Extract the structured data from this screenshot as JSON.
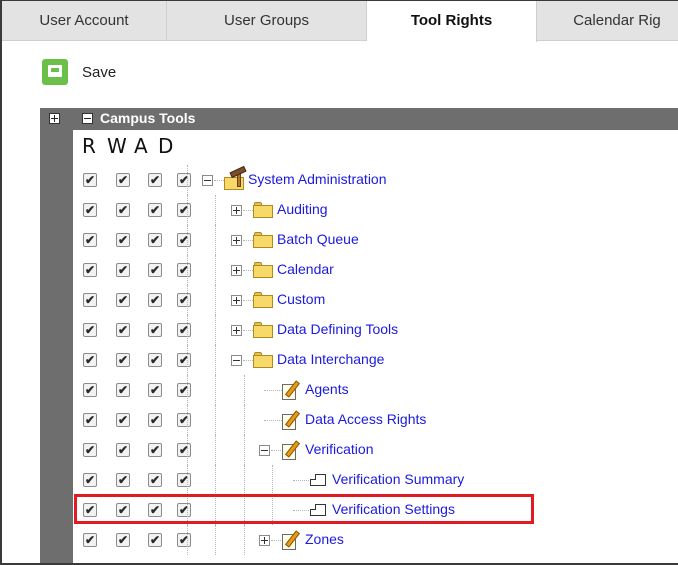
{
  "tabs": [
    {
      "label": "User Account",
      "active": false
    },
    {
      "label": "User Groups",
      "active": false
    },
    {
      "label": "Tool Rights",
      "active": true
    },
    {
      "label": "Calendar Rig",
      "active": false
    }
  ],
  "toolbar": {
    "save_label": "Save",
    "save_color": "#6cc04a"
  },
  "tree_panel": {
    "header_title": "Campus Tools",
    "column_headers": [
      "R",
      "W",
      "A",
      "D"
    ],
    "check_mark": "✔",
    "rows": [
      {
        "label": "System Administration",
        "icon": "toolbox-folder-icon",
        "expander": "minus",
        "checks": [
          true,
          true,
          true,
          true
        ]
      },
      {
        "label": "Auditing",
        "icon": "folder-icon",
        "expander": "plus",
        "checks": [
          true,
          true,
          true,
          true
        ]
      },
      {
        "label": "Batch Queue",
        "icon": "folder-icon",
        "expander": "plus",
        "checks": [
          true,
          true,
          true,
          true
        ]
      },
      {
        "label": "Calendar",
        "icon": "folder-icon",
        "expander": "plus",
        "checks": [
          true,
          true,
          true,
          true
        ]
      },
      {
        "label": "Custom",
        "icon": "folder-icon",
        "expander": "plus",
        "checks": [
          true,
          true,
          true,
          true
        ]
      },
      {
        "label": "Data Defining Tools",
        "icon": "folder-icon",
        "expander": "plus",
        "checks": [
          true,
          true,
          true,
          true
        ]
      },
      {
        "label": "Data Interchange",
        "icon": "folder-icon",
        "expander": "minus",
        "checks": [
          true,
          true,
          true,
          true
        ]
      },
      {
        "label": "Agents",
        "icon": "tool-icon",
        "expander": "none",
        "checks": [
          true,
          true,
          true,
          true
        ]
      },
      {
        "label": "Data Access Rights",
        "icon": "tool-icon",
        "expander": "none",
        "checks": [
          true,
          true,
          true,
          true
        ]
      },
      {
        "label": "Verification",
        "icon": "tool-icon",
        "expander": "minus",
        "checks": [
          true,
          true,
          true,
          true
        ]
      },
      {
        "label": "Verification Summary",
        "icon": "page-icon",
        "expander": "none",
        "checks": [
          true,
          true,
          true,
          true
        ]
      },
      {
        "label": "Verification Settings",
        "icon": "page-icon",
        "expander": "none",
        "checks": [
          true,
          true,
          true,
          true
        ],
        "highlighted": true
      },
      {
        "label": "Zones",
        "icon": "tool-icon",
        "expander": "plus",
        "checks": [
          true,
          true,
          true,
          true
        ]
      }
    ]
  },
  "colors": {
    "link": "#1a1ae0",
    "header_bg": "#6e6e6e",
    "highlight_border": "#e01b24"
  }
}
